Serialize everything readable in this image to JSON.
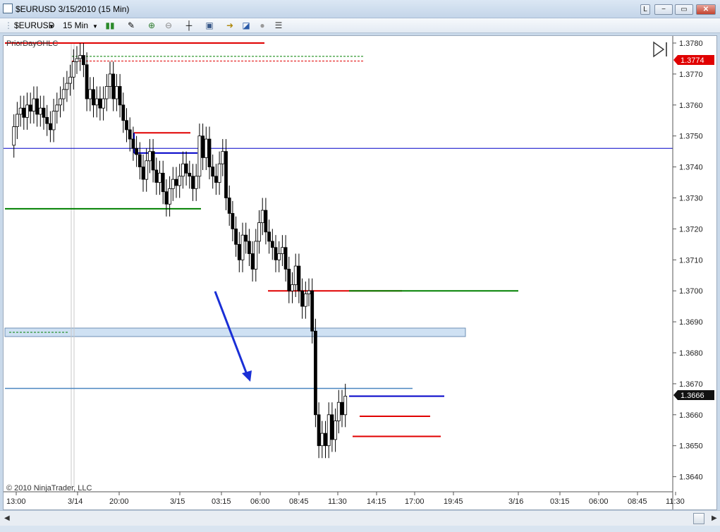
{
  "window": {
    "title": "$EURUSD  3/15/2010 (15 Min)",
    "buttons": {
      "link": "L",
      "minimize": "−",
      "maximize": "▭",
      "close": "✕"
    }
  },
  "toolbar": {
    "instrument": "$EURUSD",
    "interval": "15 Min",
    "icons": [
      "bar-type-icon",
      "draw-pencil-icon",
      "zoom-in-icon",
      "zoom-out-icon",
      "crosshair-icon",
      "snapshot-icon",
      "strategy-icon",
      "indicator-icon",
      "properties-icon",
      "data-box-icon"
    ]
  },
  "chart": {
    "indicator_label": "PriorDayOHLC",
    "copyright": "© 2010 NinjaTrader, LLC",
    "price_axis": [
      "1.3780",
      "1.3770",
      "1.3760",
      "1.3750",
      "1.3740",
      "1.3730",
      "1.3720",
      "1.3710",
      "1.3700",
      "1.3690",
      "1.3680",
      "1.3670",
      "1.3660",
      "1.3650",
      "1.3640"
    ],
    "last_price": "1.3666",
    "high_price": "1.3774",
    "time_axis": [
      "13:00",
      "3/14",
      "20:00",
      "3/15",
      "03:15",
      "06:00",
      "08:45",
      "11:30",
      "14:15",
      "17:00",
      "19:45",
      "3/16",
      "03:15",
      "06:00",
      "08:45",
      "11:30"
    ],
    "colors": {
      "up": "#ffffff",
      "down": "#000000",
      "resistance": "#e00000",
      "support": "#008000",
      "pivot": "#0000c8",
      "arrow": "#1a2fd6",
      "zone": "#cfe1f3"
    }
  }
}
